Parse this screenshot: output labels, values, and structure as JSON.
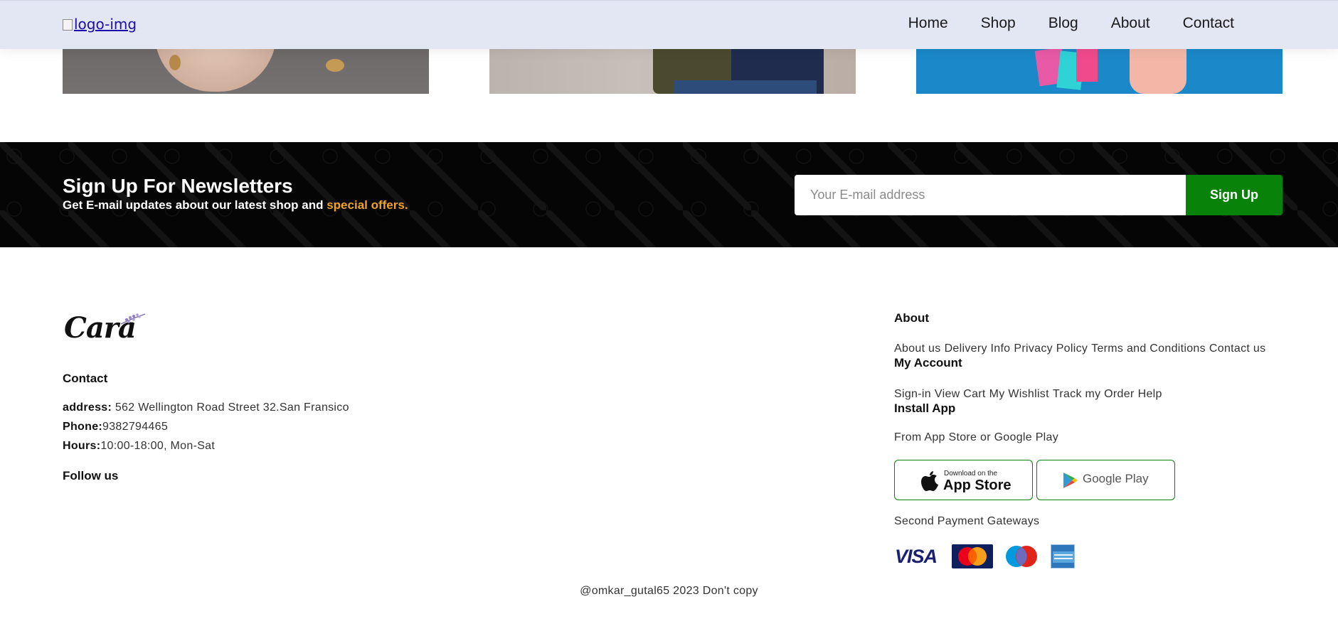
{
  "header": {
    "logo_alt": "logo-img",
    "nav": [
      "Home",
      "Shop",
      "Blog",
      "About",
      "Contact"
    ]
  },
  "newsletter": {
    "title": "Sign Up For Newsletters",
    "subtitle_prefix": "Get E-mail updates about our latest shop and ",
    "subtitle_accent": "special offers.",
    "input_placeholder": "Your E-mail address",
    "button_label": "Sign Up",
    "accent_color": "#f1a22c",
    "button_color": "#088208"
  },
  "footer": {
    "brand": "Cara",
    "contact": {
      "heading": "Contact",
      "address_label": "address:",
      "address_value": " 562 Wellington Road Street 32.San Fransico",
      "phone_label": "Phone:",
      "phone_value": "9382794465",
      "hours_label": "Hours:",
      "hours_value": "10:00-18:00, Mon-Sat"
    },
    "follow_heading": "Follow us",
    "about": {
      "heading": "About",
      "links": [
        "About us",
        "Delivery Info",
        "Privacy Policy",
        "Terms and Conditions",
        "Contact us"
      ]
    },
    "account": {
      "heading": "My Account",
      "links": [
        "Sign-in",
        "View Cart",
        "My Wishlist",
        "Track my Order",
        "Help"
      ]
    },
    "install": {
      "heading": "Install App",
      "text": "From App Store or Google Play",
      "app_store_small": "Download on the",
      "app_store_big": "App Store",
      "google_play": "Google Play"
    },
    "payments": {
      "text": "Second Payment Gateways",
      "visa": "VISA",
      "mastercard": "MasterCard",
      "maestro": "Maestro",
      "amex": "AMERICAN EXPRESS"
    },
    "copyright": "@omkar_gutal65 2023 Don't copy"
  }
}
